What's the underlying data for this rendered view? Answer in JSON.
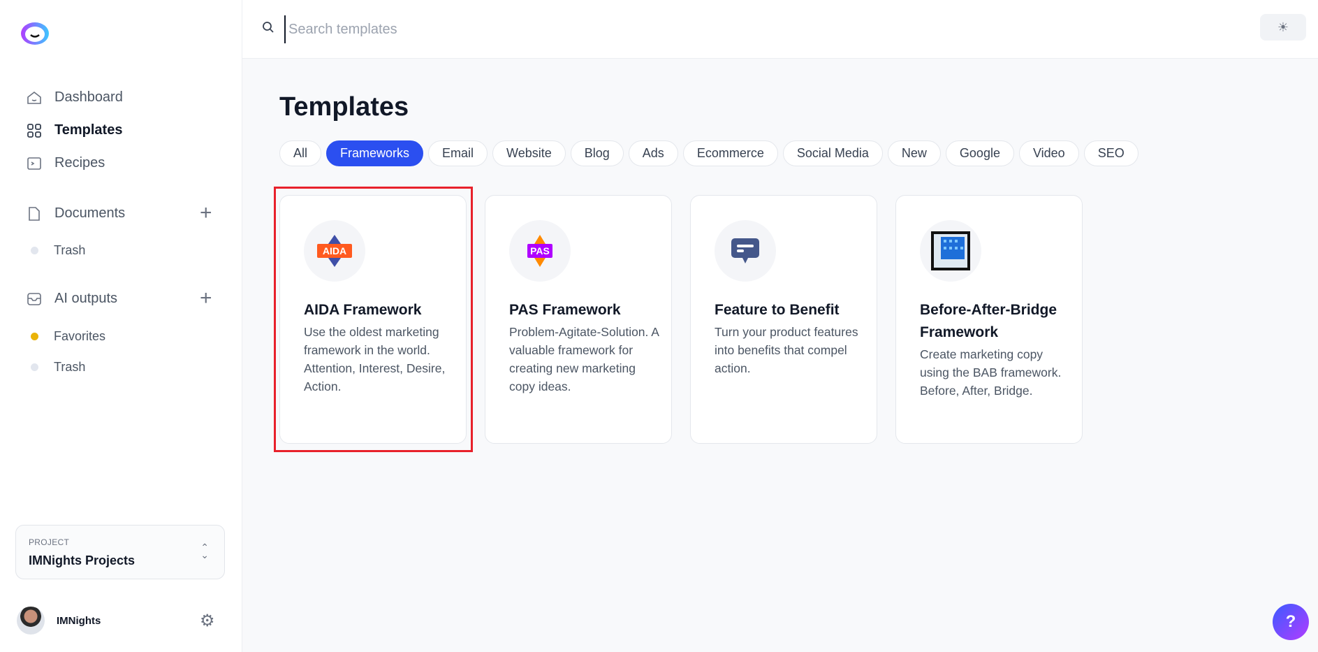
{
  "sidebar": {
    "nav": [
      {
        "label": "Dashboard",
        "icon": "home-icon"
      },
      {
        "label": "Templates",
        "icon": "grid-icon",
        "active": true
      },
      {
        "label": "Recipes",
        "icon": "terminal-icon"
      }
    ],
    "documents": {
      "label": "Documents",
      "items": [
        {
          "label": "Trash"
        }
      ]
    },
    "ai_outputs": {
      "label": "AI outputs",
      "items": [
        {
          "label": "Favorites",
          "color": "#eab308"
        },
        {
          "label": "Trash"
        }
      ]
    },
    "project": {
      "label": "PROJECT",
      "name": "IMNights Projects"
    },
    "user": {
      "name": "IMNights"
    }
  },
  "topbar": {
    "search_placeholder": "Search templates",
    "search_value": ""
  },
  "main": {
    "title": "Templates",
    "filters": [
      {
        "label": "All"
      },
      {
        "label": "Frameworks",
        "active": true
      },
      {
        "label": "Email"
      },
      {
        "label": "Website"
      },
      {
        "label": "Blog"
      },
      {
        "label": "Ads"
      },
      {
        "label": "Ecommerce"
      },
      {
        "label": "Social Media"
      },
      {
        "label": "New"
      },
      {
        "label": "Google"
      },
      {
        "label": "Video"
      },
      {
        "label": "SEO"
      }
    ],
    "cards": [
      {
        "title": "AIDA Framework",
        "description": "Use the oldest marketing framework in the world. Attention, Interest, Desire, Action.",
        "badge": "AIDA"
      },
      {
        "title": "PAS Framework",
        "description": "Problem-Agitate-Solution. A valuable framework for creating new marketing copy ideas.",
        "badge": "PAS"
      },
      {
        "title": "Feature to Benefit",
        "description": "Turn your product features into benefits that compel action."
      },
      {
        "title": "Before-After-Bridge Framework",
        "description": "Create marketing copy using the BAB framework. Before, After, Bridge."
      }
    ]
  },
  "help": {
    "label": "?"
  },
  "colors": {
    "accent": "#2b4ff0",
    "highlight": "#e8212b"
  }
}
